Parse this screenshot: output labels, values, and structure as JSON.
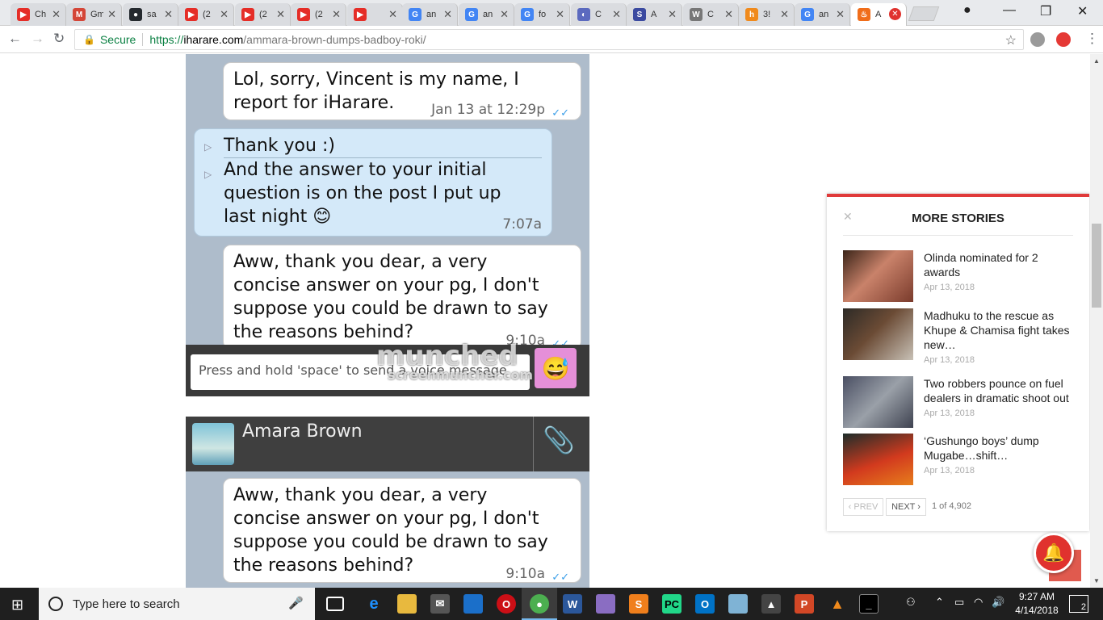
{
  "browser": {
    "tabs": [
      {
        "label": "Ch",
        "icon": "youtube-icon",
        "color": "#e52d27",
        "glyph": "▶"
      },
      {
        "label": "Gm",
        "icon": "gmail-icon",
        "color": "#d44638",
        "glyph": "M"
      },
      {
        "label": "sa",
        "icon": "github-icon",
        "color": "#24292e",
        "glyph": "●"
      },
      {
        "label": "(2",
        "icon": "youtube-icon",
        "color": "#e52d27",
        "glyph": "▶"
      },
      {
        "label": "(2",
        "icon": "youtube-icon",
        "color": "#e52d27",
        "glyph": "▶"
      },
      {
        "label": "(2",
        "icon": "youtube-icon",
        "color": "#e52d27",
        "glyph": "▶"
      },
      {
        "label": "",
        "icon": "youtube-audio-icon",
        "color": "#e52d27",
        "glyph": "▶"
      },
      {
        "label": "an",
        "icon": "google-icon",
        "color": "#4285f4",
        "glyph": "G"
      },
      {
        "label": "an",
        "icon": "google-icon",
        "color": "#4285f4",
        "glyph": "G"
      },
      {
        "label": "fo",
        "icon": "google-icon",
        "color": "#4285f4",
        "glyph": "G"
      },
      {
        "label": "C",
        "icon": "site-icon",
        "color": "#5b6abf",
        "glyph": "◐"
      },
      {
        "label": "A",
        "icon": "s-icon",
        "color": "#3b4aa0",
        "glyph": "S"
      },
      {
        "label": "C",
        "icon": "wikipedia-icon",
        "color": "#777777",
        "glyph": "W"
      },
      {
        "label": "3!",
        "icon": "her-icon",
        "color": "#f08a1c",
        "glyph": "h"
      },
      {
        "label": "an",
        "icon": "google-icon",
        "color": "#4285f4",
        "glyph": "G"
      },
      {
        "label": "A",
        "icon": "iharare-icon",
        "color": "#f06d1a",
        "glyph": "♨"
      }
    ],
    "secure_label": "Secure",
    "url_scheme": "https://",
    "url_host": "iharare.com",
    "url_path": "/ammara-brown-dumps-badboy-roki/"
  },
  "chat1": {
    "msg1_line1": "Lol, sorry, Vincent is my name, I",
    "msg1_line2": "report for iHarare.",
    "msg1_time": "Jan 13 at 12:29p",
    "msg2_part1": "Thank you :)",
    "msg2_line1": "And the answer to your initial",
    "msg2_line2": "question is on the post I put up",
    "msg2_line3": "last night 😊",
    "msg2_time": "7:07a",
    "msg3_line1": "Aww, thank you dear, a very",
    "msg3_line2": "concise answer on your pg, I don't",
    "msg3_line3": "suppose you could be drawn to say",
    "msg3_line4": "the reasons behind?",
    "msg3_time": "9:10a",
    "input_placeholder": "Press and hold 'space' to send a voice message",
    "watermark_big": "munched",
    "watermark_small": "screenmuncher.com"
  },
  "chat2": {
    "contact_name": "Amara Brown",
    "msg_line1": "Aww, thank you dear, a very",
    "msg_line2": "concise answer on your pg, I don't",
    "msg_line3": "suppose you could be drawn to say",
    "msg_line4": "the reasons behind?",
    "msg_time": "9:10a"
  },
  "more_stories": {
    "title": "MORE STORIES",
    "stories": [
      {
        "title": "Olinda nominated for 2 awards",
        "date": "Apr 13, 2018"
      },
      {
        "title": "Madhuku to the rescue as Khupe & Chamisa fight takes new…",
        "date": "Apr 13, 2018"
      },
      {
        "title": "Two robbers pounce on fuel dealers in dramatic shoot out",
        "date": "Apr 13, 2018"
      },
      {
        "title": "‘Gushungo boys’ dump Mugabe…shift…",
        "date": "Apr 13, 2018"
      }
    ],
    "prev_label": "‹ PREV",
    "next_label": "NEXT ›",
    "page_info": "1 of 4,902"
  },
  "taskbar": {
    "search_placeholder": "Type here to search",
    "time": "9:27 AM",
    "date": "4/14/2018",
    "notification_count": "2"
  }
}
